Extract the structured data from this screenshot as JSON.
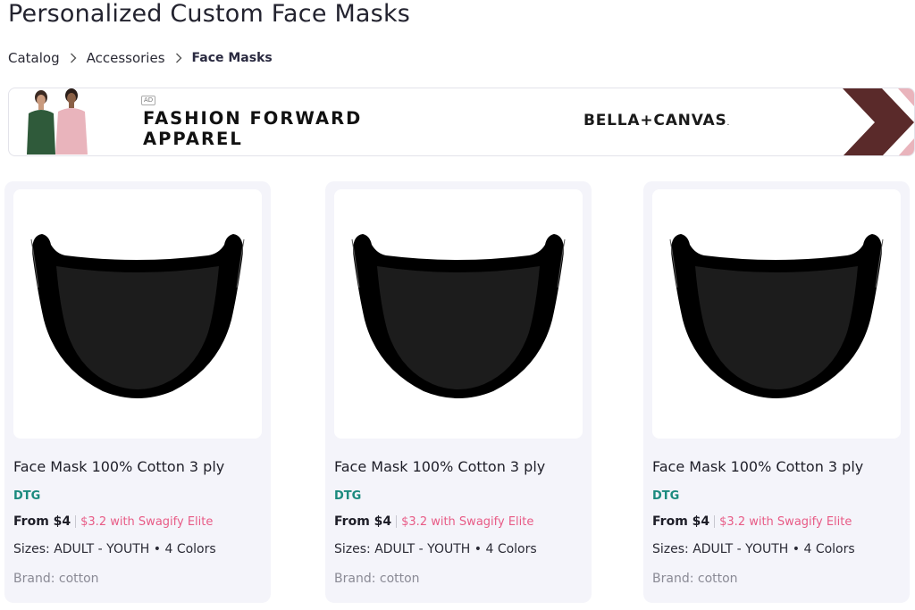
{
  "page": {
    "title": "Personalized Custom Face Masks"
  },
  "breadcrumb": {
    "items": [
      "Catalog",
      "Accessories"
    ],
    "current": "Face Masks",
    "separator_icon": "chevron-right-icon"
  },
  "ad": {
    "tag": "AD",
    "headline_line1": "FASHION FORWARD",
    "headline_line2": "APPAREL",
    "brand_name": "BELLA+CANVAS",
    "brand_suffix": ".",
    "chevron_color": "#5a2a2a",
    "accent_color": "#e9b4bc"
  },
  "products": [
    {
      "name": "Face Mask 100% Cotton 3 ply",
      "method": "DTG",
      "price": "From $4",
      "elite_price": "$3.2 with Swagify Elite",
      "sizes": "Sizes: ADULT - YOUTH • 4 Colors",
      "brand": "Brand: cotton",
      "image": "black-face-mask"
    },
    {
      "name": "Face Mask 100% Cotton 3 ply",
      "method": "DTG",
      "price": "From $4",
      "elite_price": "$3.2 with Swagify Elite",
      "sizes": "Sizes: ADULT - YOUTH • 4 Colors",
      "brand": "Brand: cotton",
      "image": "black-face-mask"
    },
    {
      "name": "Face Mask 100% Cotton 3 ply",
      "method": "DTG",
      "price": "From $4",
      "elite_price": "$3.2 with Swagify Elite",
      "sizes": "Sizes: ADULT - YOUTH • 4 Colors",
      "brand": "Brand: cotton",
      "image": "black-face-mask"
    }
  ],
  "colors": {
    "method": "#1b8a7e",
    "elite": "#e85b86",
    "card_bg": "#f4f4fa"
  }
}
